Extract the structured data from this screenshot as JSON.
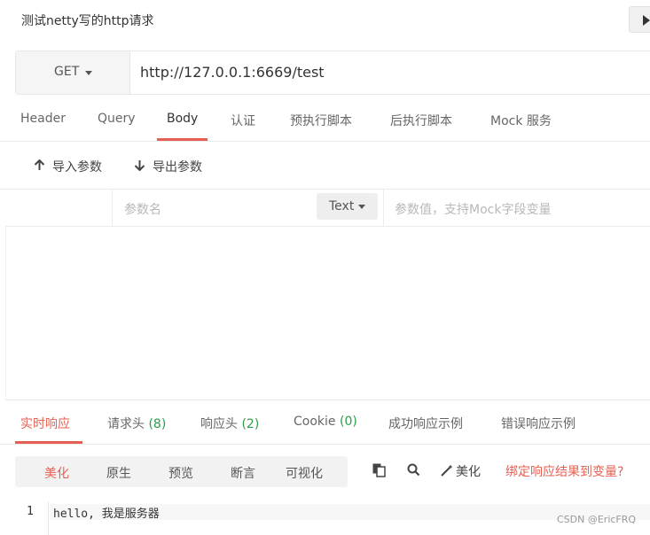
{
  "request": {
    "title": "测试netty写的http请求",
    "method": "GET",
    "url": "http://127.0.0.1:6669/test"
  },
  "request_tabs": [
    {
      "label": "Header"
    },
    {
      "label": "Query"
    },
    {
      "label": "Body",
      "active": true
    },
    {
      "label": "认证"
    },
    {
      "label": "预执行脚本"
    },
    {
      "label": "后执行脚本"
    },
    {
      "label": "Mock 服务"
    }
  ],
  "body_tools": {
    "import_label": "导入参数",
    "export_label": "导出参数"
  },
  "param_row": {
    "name_placeholder": "参数名",
    "type": "Text",
    "value_placeholder": "参数值，支持Mock字段变量"
  },
  "response_tabs": [
    {
      "label": "实时响应",
      "active": true
    },
    {
      "label": "请求头",
      "count": "(8)"
    },
    {
      "label": "响应头",
      "count": "(2)"
    },
    {
      "label": "Cookie",
      "count": "(0)"
    },
    {
      "label": "成功响应示例"
    },
    {
      "label": "错误响应示例"
    }
  ],
  "view_modes": [
    {
      "label": "美化",
      "active": true
    },
    {
      "label": "原生"
    },
    {
      "label": "预览"
    },
    {
      "label": "断言"
    },
    {
      "label": "可视化"
    }
  ],
  "response_toolbar": {
    "beautify_label": "美化",
    "bind_label": "绑定响应结果到变量?"
  },
  "response_body": {
    "line_number": "1",
    "line_text": "hello, 我是服务器"
  },
  "watermark": "CSDN @EricFRQ",
  "colors": {
    "accent": "#e65f52",
    "count": "#2a9d4a"
  },
  "icons": [
    "play-icon",
    "caret-down-icon",
    "arrow-up-icon",
    "arrow-down-icon",
    "copy-icon",
    "search-icon",
    "magic-wand-icon"
  ]
}
